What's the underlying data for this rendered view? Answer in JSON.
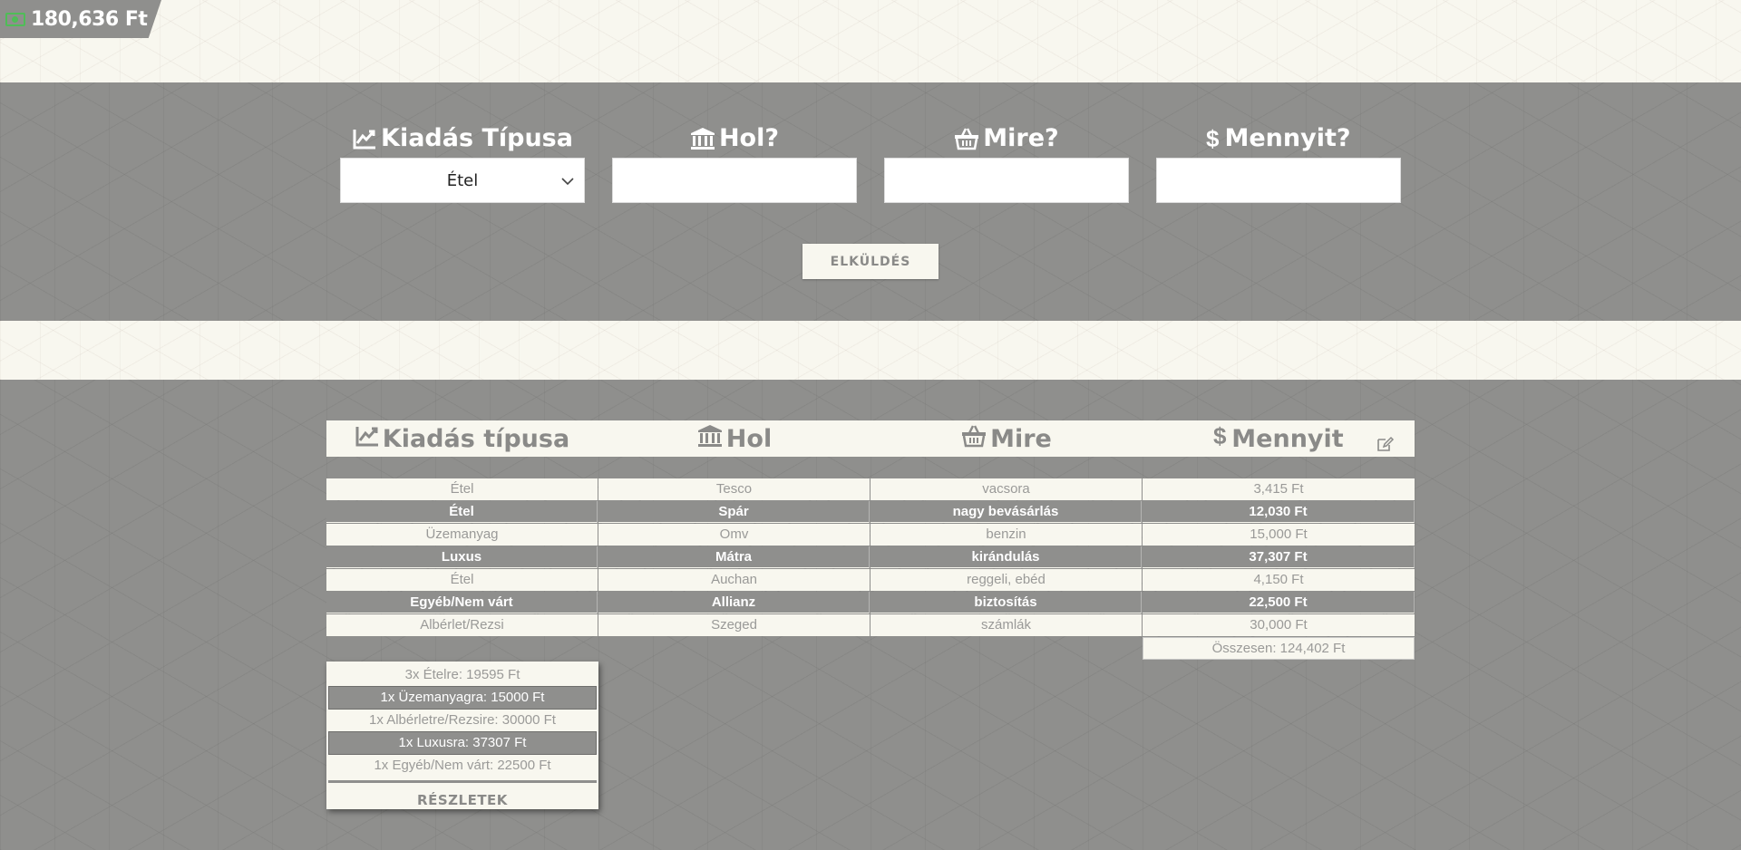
{
  "balance": {
    "amount": "180,636 Ft",
    "icon": "cash-icon"
  },
  "form": {
    "type_label": "Kiadás Típusa",
    "where_label": "Hol?",
    "what_label": "Mire?",
    "amount_label": "Mennyit?",
    "type_selected": "Étel",
    "where_value": "",
    "what_value": "",
    "amount_value": "",
    "submit_label": "ELKÜLDÉS"
  },
  "table": {
    "headers": [
      "Kiadás típusa",
      "Hol",
      "Mire",
      "Mennyit"
    ],
    "rows": [
      [
        "Étel",
        "Tesco",
        "vacsora",
        "3,415 Ft"
      ],
      [
        "Étel",
        "Spár",
        "nagy bevásárlás",
        "12,030 Ft"
      ],
      [
        "Üzemanyag",
        "Omv",
        "benzin",
        "15,000 Ft"
      ],
      [
        "Luxus",
        "Mátra",
        "kirándulás",
        "37,307 Ft"
      ],
      [
        "Étel",
        "Auchan",
        "reggeli, ebéd",
        "4,150 Ft"
      ],
      [
        "Egyéb/Nem várt",
        "Allianz",
        "biztosítás",
        "22,500 Ft"
      ],
      [
        "Albérlet/Rezsi",
        "Szeged",
        "számlák",
        "30,000 Ft"
      ]
    ],
    "total": "Összesen: 124,402 Ft"
  },
  "summary": {
    "items": [
      "3x Ételre: 19595 Ft",
      "1x Üzemanyagra: 15000 Ft",
      "1x Albérletre/Rezsire: 30000 Ft",
      "1x Luxusra: 37307 Ft",
      "1x Egyéb/Nem várt: 22500 Ft"
    ],
    "details_label": "RÉSZLETEK"
  },
  "colors": {
    "background_gray": "#8f8f8d",
    "background_light": "#f8f7ef",
    "accent_green": "#4fbd57"
  }
}
